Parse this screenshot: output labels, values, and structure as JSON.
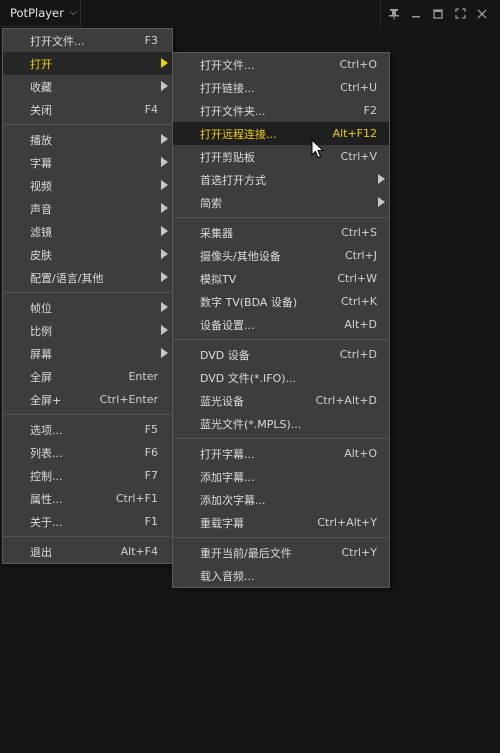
{
  "titlebar": {
    "app_name": "PotPlayer",
    "chevron": "⌵",
    "controls": [
      "pin-icon",
      "minimize-icon",
      "maximize-icon",
      "fullscreen-icon",
      "close-icon"
    ]
  },
  "main_menu": {
    "groups": [
      [
        {
          "label": "打开文件...",
          "shortcut": "F3",
          "submenu": false
        },
        {
          "label": "打开",
          "shortcut": "",
          "submenu": true,
          "state": "active"
        },
        {
          "label": "收藏",
          "shortcut": "",
          "submenu": true
        },
        {
          "label": "关闭",
          "shortcut": "F4",
          "submenu": false
        }
      ],
      [
        {
          "label": "播放",
          "shortcut": "",
          "submenu": true
        },
        {
          "label": "字幕",
          "shortcut": "",
          "submenu": true
        },
        {
          "label": "视频",
          "shortcut": "",
          "submenu": true
        },
        {
          "label": "声音",
          "shortcut": "",
          "submenu": true
        },
        {
          "label": "滤镜",
          "shortcut": "",
          "submenu": true
        },
        {
          "label": "皮肤",
          "shortcut": "",
          "submenu": true
        },
        {
          "label": "配置/语言/其他",
          "shortcut": "",
          "submenu": true
        }
      ],
      [
        {
          "label": "帧位",
          "shortcut": "",
          "submenu": true
        },
        {
          "label": "比例",
          "shortcut": "",
          "submenu": true
        },
        {
          "label": "屏幕",
          "shortcut": "",
          "submenu": true
        },
        {
          "label": "全屏",
          "shortcut": "Enter",
          "submenu": false
        },
        {
          "label": "全屏+",
          "shortcut": "Ctrl+Enter",
          "submenu": false
        }
      ],
      [
        {
          "label": "选项...",
          "shortcut": "F5",
          "submenu": false
        },
        {
          "label": "列表...",
          "shortcut": "F6",
          "submenu": false
        },
        {
          "label": "控制...",
          "shortcut": "F7",
          "submenu": false
        },
        {
          "label": "属性...",
          "shortcut": "Ctrl+F1",
          "submenu": false
        },
        {
          "label": "关于...",
          "shortcut": "F1",
          "submenu": false
        }
      ],
      [
        {
          "label": "退出",
          "shortcut": "Alt+F4",
          "submenu": false
        }
      ]
    ]
  },
  "open_submenu": {
    "groups": [
      [
        {
          "label": "打开文件...",
          "shortcut": "Ctrl+O",
          "submenu": false
        },
        {
          "label": "打开链接...",
          "shortcut": "Ctrl+U",
          "submenu": false
        },
        {
          "label": "打开文件夹...",
          "shortcut": "F2",
          "submenu": false
        },
        {
          "label": "打开远程连接...",
          "shortcut": "Alt+F12",
          "submenu": false,
          "state": "hover"
        },
        {
          "label": "打开剪贴板",
          "shortcut": "Ctrl+V",
          "submenu": false
        },
        {
          "label": "首选打开方式",
          "shortcut": "",
          "submenu": true
        },
        {
          "label": "简索",
          "shortcut": "",
          "submenu": true
        }
      ],
      [
        {
          "label": "采集器",
          "shortcut": "Ctrl+S",
          "submenu": false
        },
        {
          "label": "摄像头/其他设备",
          "shortcut": "Ctrl+J",
          "submenu": false
        },
        {
          "label": "模拟TV",
          "shortcut": "Ctrl+W",
          "submenu": false
        },
        {
          "label": "数字 TV(BDA 设备)",
          "shortcut": "Ctrl+K",
          "submenu": false
        },
        {
          "label": "设备设置...",
          "shortcut": "Alt+D",
          "submenu": false
        }
      ],
      [
        {
          "label": "DVD 设备",
          "shortcut": "Ctrl+D",
          "submenu": false
        },
        {
          "label": "DVD 文件(*.IFO)...",
          "shortcut": "",
          "submenu": false
        },
        {
          "label": "蓝光设备",
          "shortcut": "Ctrl+Alt+D",
          "submenu": false
        },
        {
          "label": "蓝光文件(*.MPLS)...",
          "shortcut": "",
          "submenu": false
        }
      ],
      [
        {
          "label": "打开字幕...",
          "shortcut": "Alt+O",
          "submenu": false
        },
        {
          "label": "添加字幕...",
          "shortcut": "",
          "submenu": false
        },
        {
          "label": "添加次字幕...",
          "shortcut": "",
          "submenu": false
        },
        {
          "label": "重载字幕",
          "shortcut": "Ctrl+Alt+Y",
          "submenu": false
        }
      ],
      [
        {
          "label": "重开当前/最后文件",
          "shortcut": "Ctrl+Y",
          "submenu": false
        },
        {
          "label": "载入音频...",
          "shortcut": "",
          "submenu": false
        }
      ]
    ]
  },
  "colors": {
    "background": "#151515",
    "menu_bg": "#3d3d3d",
    "highlight_text": "#f0d000"
  }
}
